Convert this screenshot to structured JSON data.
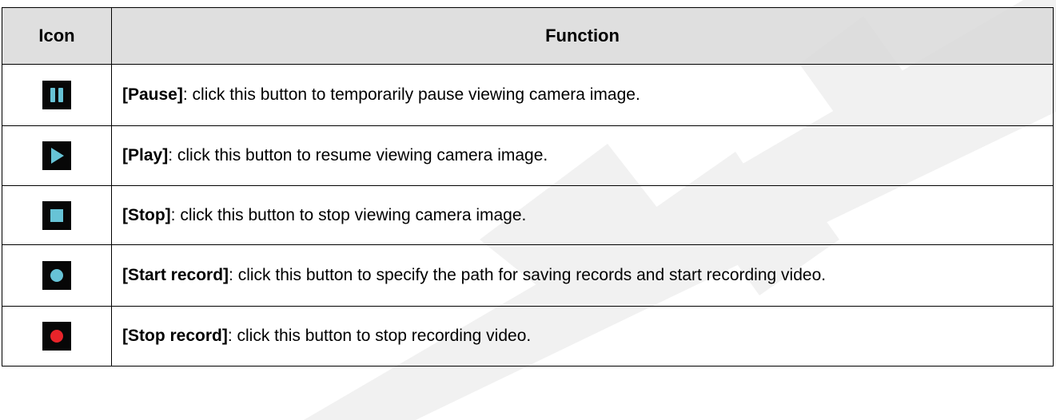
{
  "table": {
    "headers": {
      "icon": "Icon",
      "function": "Function"
    },
    "rows": [
      {
        "icon": "pause-icon",
        "term": "[Pause]",
        "description": ": click this button to temporarily pause viewing camera image."
      },
      {
        "icon": "play-icon",
        "term": "[Play]",
        "description": ": click this button to resume viewing camera image."
      },
      {
        "icon": "stop-icon",
        "term": "[Stop]",
        "description": ": click this button to stop viewing camera image."
      },
      {
        "icon": "start-record-icon",
        "term": "[Start record]",
        "description": ": click this button to specify the path for saving records and start recording video."
      },
      {
        "icon": "stop-record-icon",
        "term": "[Stop record]",
        "description": ": click this button to stop recording video."
      }
    ]
  },
  "colors": {
    "icon_background": "#070707",
    "icon_blue": "#67c3d6",
    "record_red": "#e8242a",
    "header_background": "#d9d9d9",
    "watermark": "#f1f1f1"
  }
}
